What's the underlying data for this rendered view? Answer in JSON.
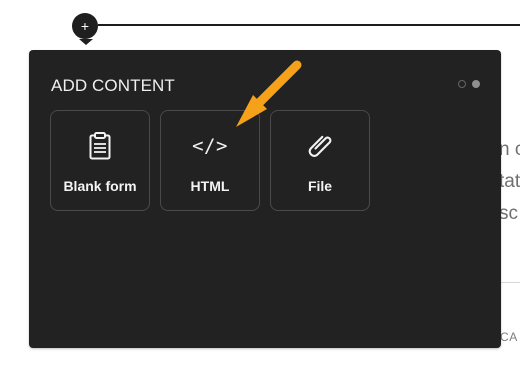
{
  "page": {
    "timeline_add_label": "+"
  },
  "background": {
    "right_text_rows": [
      "n c",
      "tat",
      "sc"
    ],
    "right_caps": "CA"
  },
  "panel": {
    "title": "ADD CONTENT",
    "pager": {
      "count": 2,
      "active_index": 1
    },
    "items": [
      {
        "label": "Blank form",
        "icon": "clipboard-icon"
      },
      {
        "label": "HTML",
        "icon": "code-icon",
        "icon_text": "</>"
      },
      {
        "label": "File",
        "icon": "paperclip-icon"
      }
    ]
  },
  "annotation": {
    "arrow_color": "#f5a11a"
  }
}
